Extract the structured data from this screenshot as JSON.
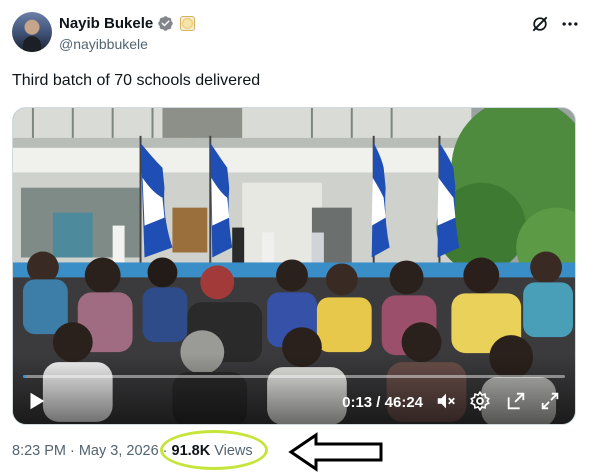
{
  "author": {
    "display_name": "Nayib Bukele",
    "handle": "@nayibbukele",
    "verified": true,
    "accent_color": "#1d9bf0"
  },
  "header_icons": [
    "grok-icon",
    "more-icon"
  ],
  "tweet": {
    "text": "Third batch of 70 schools delivered"
  },
  "video": {
    "time_display": "0:13 / 46:24",
    "progress_fraction": 0.005,
    "controls": [
      "play-icon",
      "mute-icon",
      "settings-icon",
      "pip-icon",
      "fullscreen-icon"
    ]
  },
  "meta": {
    "time": "8:23 PM",
    "separator": "·",
    "date": "May 3, 2026",
    "views_count": "91.8K",
    "views_label": "Views"
  },
  "annotation": {
    "highlight_color": "#c6e53a",
    "arrow": "arrow-left-icon"
  }
}
